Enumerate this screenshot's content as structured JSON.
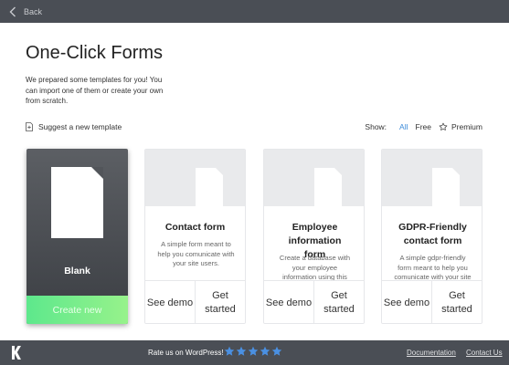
{
  "topbar": {
    "back_label": "Back"
  },
  "header": {
    "title": "One-Click Forms",
    "intro": "We prepared some templates for you! You can import one of them or create your own from scratch."
  },
  "toolbar": {
    "suggest_label": "Suggest a new template",
    "show_label": "Show:",
    "filters": {
      "all": "All",
      "free": "Free",
      "premium": "Premium"
    },
    "active_filter": "All"
  },
  "blank_card": {
    "title": "Blank",
    "create_label": "Create new"
  },
  "templates": [
    {
      "title": "Contact form",
      "description": "A simple form meant to help you comunicate with your site users.",
      "demo_label": "See demo",
      "start_label": "Get started"
    },
    {
      "title": "Employee information form",
      "description": "Create a database with your employee information using this form.",
      "demo_label": "See demo",
      "start_label": "Get started"
    },
    {
      "title": "GDPR-Friendly contact form",
      "description": "A simple gdpr-friendly form meant to help you comunicate with your site users.",
      "demo_label": "See demo",
      "start_label": "Get started"
    }
  ],
  "footer": {
    "rate_text": "Rate us on WordPress!",
    "stars": 5,
    "documentation_label": "Documentation",
    "contact_label": "Contact Us"
  },
  "colors": {
    "accent": "#3d8bd9",
    "create_green": "#6ee68c",
    "topbar": "#4a4e55",
    "star": "#4a90e2"
  },
  "icons": {
    "back": "chevron-left-icon",
    "suggest": "document-icon",
    "premium": "star-outline-icon",
    "logo": "k-logo-icon"
  }
}
